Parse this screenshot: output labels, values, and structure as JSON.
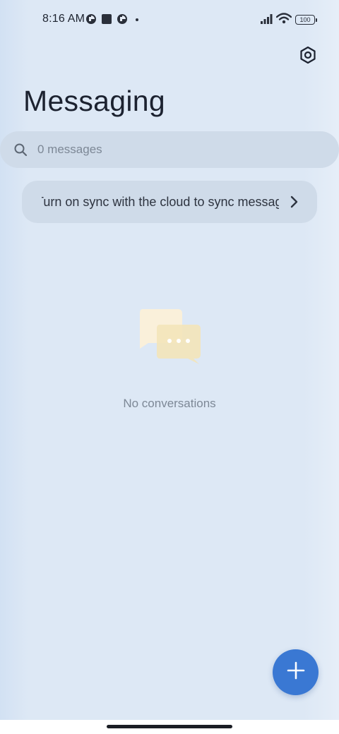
{
  "status_bar": {
    "time": "8:16 AM",
    "battery": "100",
    "icons": [
      "app-notification-icon",
      "stop-square-icon",
      "app-notification-icon",
      "dot-icon",
      "signal-icon",
      "wifi-icon",
      "battery-icon"
    ]
  },
  "header": {
    "title": "Messaging",
    "settings_icon": "settings-hexagon-icon"
  },
  "search": {
    "placeholder": "0 messages",
    "value": "",
    "icon": "search-icon"
  },
  "sync_banner": {
    "text": "Turn on sync with the cloud to sync messages",
    "icon": "chevron-right-icon"
  },
  "empty_state": {
    "text": "No conversations",
    "icon": "chat-bubbles-icon"
  },
  "fab": {
    "icon": "plus-icon",
    "color": "#3a78d3"
  }
}
